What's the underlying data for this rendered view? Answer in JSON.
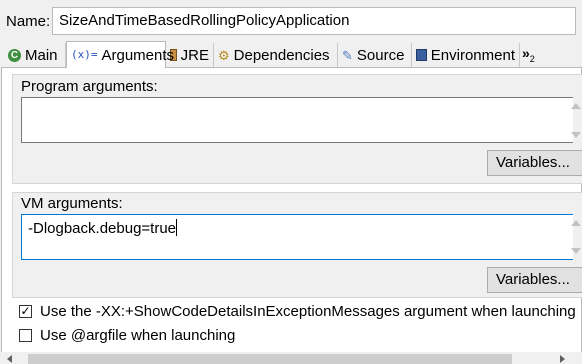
{
  "name_field": {
    "label": "Name:",
    "value": "SizeAndTimeBasedRollingPolicyApplication"
  },
  "tabs": [
    {
      "label": "Main",
      "icon": "main-icon",
      "active": false
    },
    {
      "label": "Arguments",
      "icon": "arguments-icon",
      "active": true
    },
    {
      "label": "JRE",
      "icon": "jre-icon",
      "active": false
    },
    {
      "label": "Dependencies",
      "icon": "dependencies-icon",
      "active": false
    },
    {
      "label": "Source",
      "icon": "source-icon",
      "active": false
    },
    {
      "label": "Environment",
      "icon": "environment-icon",
      "active": false
    }
  ],
  "tabs_overflow": {
    "label": "»",
    "count": "2"
  },
  "program_arguments": {
    "label": "Program arguments:",
    "value": "",
    "variables_button": "Variables..."
  },
  "vm_arguments": {
    "label": "VM arguments:",
    "value": "-Dlogback.debug=true",
    "variables_button": "Variables..."
  },
  "options": {
    "show_code_details": {
      "label": "Use the -XX:+ShowCodeDetailsInExceptionMessages argument when launching",
      "checked": true
    },
    "argfile": {
      "label": "Use @argfile when launching",
      "checked": false
    }
  },
  "icons": {
    "arguments_glyph": "(x)=",
    "main_glyph": "C",
    "dependencies_glyph": "⚙",
    "source_glyph": "✎"
  }
}
